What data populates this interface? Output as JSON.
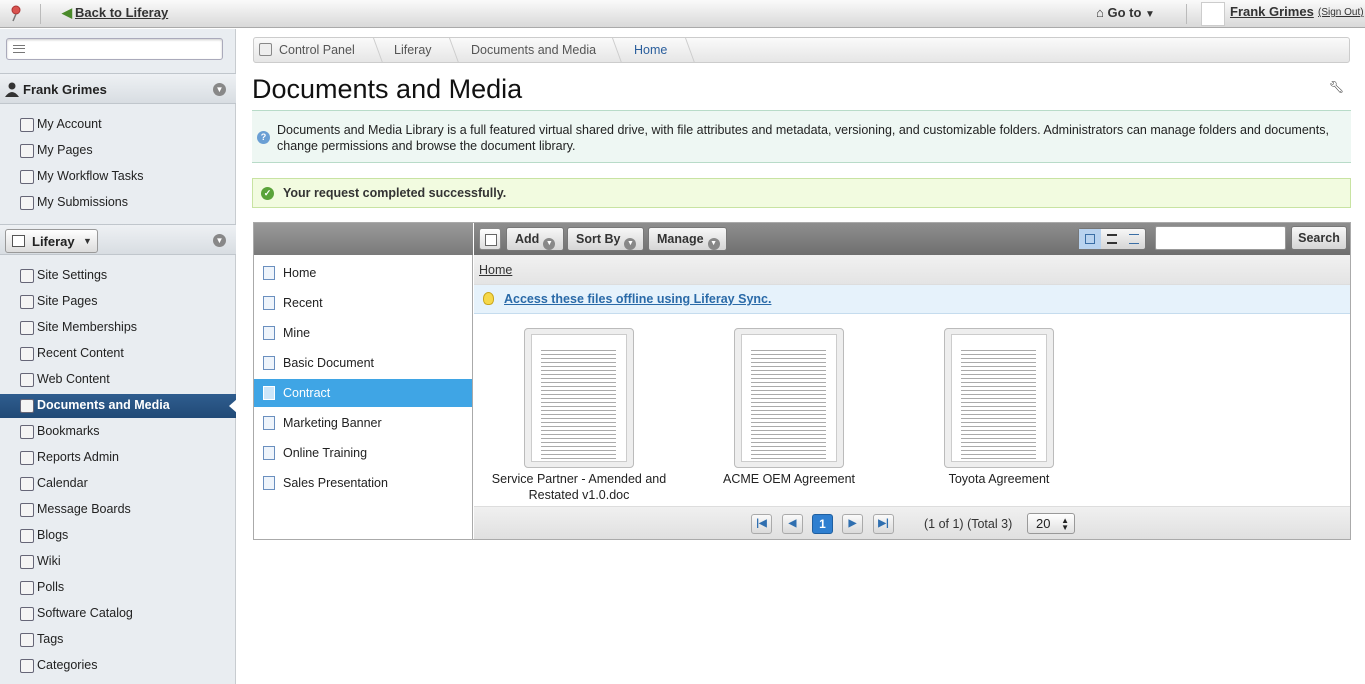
{
  "topbar": {
    "back_label": "Back to Liferay",
    "goto_label": "Go to",
    "user_name": "Frank Grimes",
    "sign_out": "(Sign Out)"
  },
  "sidebar": {
    "user_panel_title": "Frank Grimes",
    "user_items": [
      {
        "label": "My Account",
        "icon": "account-icon"
      },
      {
        "label": "My Pages",
        "icon": "pages-icon"
      },
      {
        "label": "My Workflow Tasks",
        "icon": "workflow-icon"
      },
      {
        "label": "My Submissions",
        "icon": "submissions-icon"
      }
    ],
    "site_selector": "Liferay",
    "site_items": [
      {
        "label": "Site Settings",
        "icon": "gear-icon"
      },
      {
        "label": "Site Pages",
        "icon": "pages-icon"
      },
      {
        "label": "Site Memberships",
        "icon": "members-icon"
      },
      {
        "label": "Recent Content",
        "icon": "recent-icon"
      },
      {
        "label": "Web Content",
        "icon": "web-content-icon"
      },
      {
        "label": "Documents and Media",
        "icon": "documents-icon",
        "active": true
      },
      {
        "label": "Bookmarks",
        "icon": "bookmarks-icon"
      },
      {
        "label": "Reports Admin",
        "icon": "reports-icon"
      },
      {
        "label": "Calendar",
        "icon": "calendar-icon"
      },
      {
        "label": "Message Boards",
        "icon": "message-boards-icon"
      },
      {
        "label": "Blogs",
        "icon": "blogs-icon"
      },
      {
        "label": "Wiki",
        "icon": "wiki-icon"
      },
      {
        "label": "Polls",
        "icon": "polls-icon"
      },
      {
        "label": "Software Catalog",
        "icon": "catalog-icon"
      },
      {
        "label": "Tags",
        "icon": "tags-icon"
      },
      {
        "label": "Categories",
        "icon": "categories-icon"
      }
    ]
  },
  "breadcrumb": [
    "Control Panel",
    "Liferay",
    "Documents and Media",
    "Home"
  ],
  "page": {
    "title": "Documents and Media",
    "description": "Documents and Media Library is a full featured virtual shared drive, with file attributes and metadata, versioning, and customizable folders. Administrators can manage folders and documents, change permissions and browse the document library.",
    "success_message": "Your request completed successfully."
  },
  "toolbar": {
    "add": "Add",
    "sort_by": "Sort By",
    "manage": "Manage",
    "search_button": "Search",
    "search_value": ""
  },
  "folders": [
    {
      "label": "Home",
      "icon": "home-icon"
    },
    {
      "label": "Recent",
      "icon": "clock-icon"
    },
    {
      "label": "Mine",
      "icon": "person-icon"
    },
    {
      "label": "Basic Document",
      "icon": "document-type-icon"
    },
    {
      "label": "Contract",
      "icon": "document-type-icon",
      "selected": true
    },
    {
      "label": "Marketing Banner",
      "icon": "document-type-icon"
    },
    {
      "label": "Online Training",
      "icon": "document-type-icon"
    },
    {
      "label": "Sales Presentation",
      "icon": "document-type-icon"
    }
  ],
  "content": {
    "crumb": "Home",
    "sync_link": "Access these files offline using Liferay Sync.",
    "documents": [
      {
        "name": "Service Partner - Amended and Restated v1.0.doc"
      },
      {
        "name": "ACME OEM Agreement"
      },
      {
        "name": "Toyota Agreement"
      }
    ]
  },
  "pagination": {
    "current_page": "1",
    "info": "(1 of 1) (Total 3)",
    "per_page": "20"
  },
  "colors": {
    "active_nav": "#2f5d8f",
    "selected_folder": "#3fa5e5",
    "link": "#2a6aa8"
  }
}
